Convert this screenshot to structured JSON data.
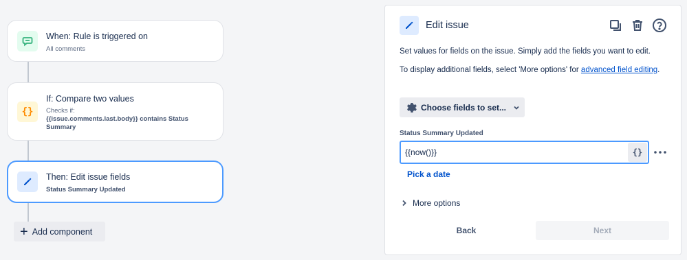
{
  "rule": {
    "trigger": {
      "title": "When: Rule is triggered on",
      "subtitle": "All comments",
      "icon": "comment-icon"
    },
    "condition": {
      "title": "If: Compare two values",
      "subtitle_prefix": "Checks if:",
      "subtitle_line1": "{{issue.comments.last.body}} contains Status",
      "subtitle_line2": "Summary",
      "icon": "curly-braces-icon"
    },
    "action": {
      "title": "Then: Edit issue fields",
      "subtitle": "Status Summary Updated",
      "icon": "pencil-icon"
    },
    "add_component_label": "Add component"
  },
  "panel": {
    "title": "Edit issue",
    "description1": "Set values for fields on the issue. Simply add the fields you want to edit.",
    "description2_prefix": "To display additional fields, select 'More options' for ",
    "description2_link": "advanced field editing",
    "description2_suffix": ".",
    "choose_fields_label": "Choose fields to set...",
    "field_label": "Status Summary Updated",
    "field_value": "{{now()}}",
    "smart_value_label": "{}",
    "pick_date_label": "Pick a date",
    "more_options_label": "More options",
    "back_label": "Back",
    "next_label": "Next"
  },
  "colors": {
    "accent": "#0052cc",
    "focus_border": "#4c9aff",
    "trigger_green": "#36b37e",
    "condition_orange": "#ff8b00"
  }
}
